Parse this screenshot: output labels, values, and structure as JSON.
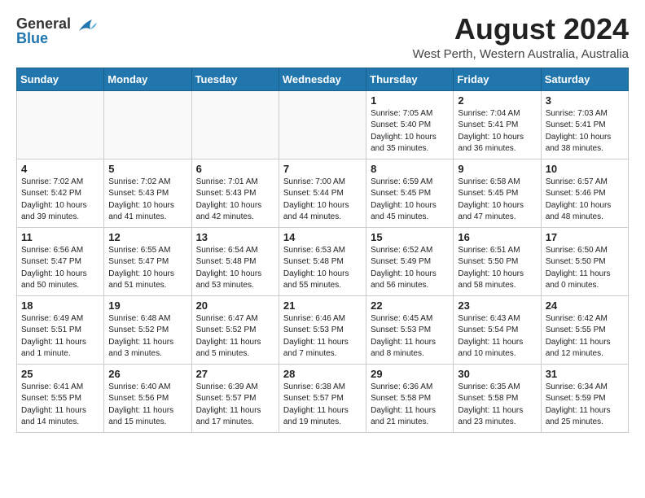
{
  "logo": {
    "general": "General",
    "blue": "Blue"
  },
  "title": "August 2024",
  "subtitle": "West Perth, Western Australia, Australia",
  "weekdays": [
    "Sunday",
    "Monday",
    "Tuesday",
    "Wednesday",
    "Thursday",
    "Friday",
    "Saturday"
  ],
  "weeks": [
    [
      {
        "day": "",
        "info": ""
      },
      {
        "day": "",
        "info": ""
      },
      {
        "day": "",
        "info": ""
      },
      {
        "day": "",
        "info": ""
      },
      {
        "day": "1",
        "info": "Sunrise: 7:05 AM\nSunset: 5:40 PM\nDaylight: 10 hours\nand 35 minutes."
      },
      {
        "day": "2",
        "info": "Sunrise: 7:04 AM\nSunset: 5:41 PM\nDaylight: 10 hours\nand 36 minutes."
      },
      {
        "day": "3",
        "info": "Sunrise: 7:03 AM\nSunset: 5:41 PM\nDaylight: 10 hours\nand 38 minutes."
      }
    ],
    [
      {
        "day": "4",
        "info": "Sunrise: 7:02 AM\nSunset: 5:42 PM\nDaylight: 10 hours\nand 39 minutes."
      },
      {
        "day": "5",
        "info": "Sunrise: 7:02 AM\nSunset: 5:43 PM\nDaylight: 10 hours\nand 41 minutes."
      },
      {
        "day": "6",
        "info": "Sunrise: 7:01 AM\nSunset: 5:43 PM\nDaylight: 10 hours\nand 42 minutes."
      },
      {
        "day": "7",
        "info": "Sunrise: 7:00 AM\nSunset: 5:44 PM\nDaylight: 10 hours\nand 44 minutes."
      },
      {
        "day": "8",
        "info": "Sunrise: 6:59 AM\nSunset: 5:45 PM\nDaylight: 10 hours\nand 45 minutes."
      },
      {
        "day": "9",
        "info": "Sunrise: 6:58 AM\nSunset: 5:45 PM\nDaylight: 10 hours\nand 47 minutes."
      },
      {
        "day": "10",
        "info": "Sunrise: 6:57 AM\nSunset: 5:46 PM\nDaylight: 10 hours\nand 48 minutes."
      }
    ],
    [
      {
        "day": "11",
        "info": "Sunrise: 6:56 AM\nSunset: 5:47 PM\nDaylight: 10 hours\nand 50 minutes."
      },
      {
        "day": "12",
        "info": "Sunrise: 6:55 AM\nSunset: 5:47 PM\nDaylight: 10 hours\nand 51 minutes."
      },
      {
        "day": "13",
        "info": "Sunrise: 6:54 AM\nSunset: 5:48 PM\nDaylight: 10 hours\nand 53 minutes."
      },
      {
        "day": "14",
        "info": "Sunrise: 6:53 AM\nSunset: 5:48 PM\nDaylight: 10 hours\nand 55 minutes."
      },
      {
        "day": "15",
        "info": "Sunrise: 6:52 AM\nSunset: 5:49 PM\nDaylight: 10 hours\nand 56 minutes."
      },
      {
        "day": "16",
        "info": "Sunrise: 6:51 AM\nSunset: 5:50 PM\nDaylight: 10 hours\nand 58 minutes."
      },
      {
        "day": "17",
        "info": "Sunrise: 6:50 AM\nSunset: 5:50 PM\nDaylight: 11 hours\nand 0 minutes."
      }
    ],
    [
      {
        "day": "18",
        "info": "Sunrise: 6:49 AM\nSunset: 5:51 PM\nDaylight: 11 hours\nand 1 minute."
      },
      {
        "day": "19",
        "info": "Sunrise: 6:48 AM\nSunset: 5:52 PM\nDaylight: 11 hours\nand 3 minutes."
      },
      {
        "day": "20",
        "info": "Sunrise: 6:47 AM\nSunset: 5:52 PM\nDaylight: 11 hours\nand 5 minutes."
      },
      {
        "day": "21",
        "info": "Sunrise: 6:46 AM\nSunset: 5:53 PM\nDaylight: 11 hours\nand 7 minutes."
      },
      {
        "day": "22",
        "info": "Sunrise: 6:45 AM\nSunset: 5:53 PM\nDaylight: 11 hours\nand 8 minutes."
      },
      {
        "day": "23",
        "info": "Sunrise: 6:43 AM\nSunset: 5:54 PM\nDaylight: 11 hours\nand 10 minutes."
      },
      {
        "day": "24",
        "info": "Sunrise: 6:42 AM\nSunset: 5:55 PM\nDaylight: 11 hours\nand 12 minutes."
      }
    ],
    [
      {
        "day": "25",
        "info": "Sunrise: 6:41 AM\nSunset: 5:55 PM\nDaylight: 11 hours\nand 14 minutes."
      },
      {
        "day": "26",
        "info": "Sunrise: 6:40 AM\nSunset: 5:56 PM\nDaylight: 11 hours\nand 15 minutes."
      },
      {
        "day": "27",
        "info": "Sunrise: 6:39 AM\nSunset: 5:57 PM\nDaylight: 11 hours\nand 17 minutes."
      },
      {
        "day": "28",
        "info": "Sunrise: 6:38 AM\nSunset: 5:57 PM\nDaylight: 11 hours\nand 19 minutes."
      },
      {
        "day": "29",
        "info": "Sunrise: 6:36 AM\nSunset: 5:58 PM\nDaylight: 11 hours\nand 21 minutes."
      },
      {
        "day": "30",
        "info": "Sunrise: 6:35 AM\nSunset: 5:58 PM\nDaylight: 11 hours\nand 23 minutes."
      },
      {
        "day": "31",
        "info": "Sunrise: 6:34 AM\nSunset: 5:59 PM\nDaylight: 11 hours\nand 25 minutes."
      }
    ]
  ]
}
